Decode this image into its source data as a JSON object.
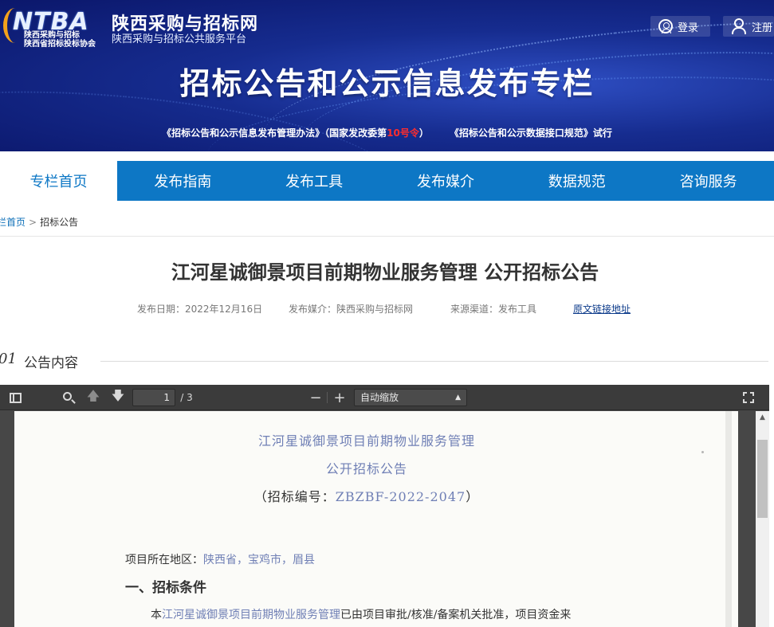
{
  "banner": {
    "logo_text": "NTBA",
    "logo_sub1": "陕西采购与招标",
    "logo_sub2": "陕西省招标投标协会",
    "site_name": "陕西采购与招标网",
    "site_sub": "陕西采购与招标公共服务平台",
    "login_label": "登录",
    "register_label": "注册",
    "title": "招标公告和公示信息发布专栏",
    "notice_part1": "《招标公告和公示信息发布管理办法》（国家发改委第",
    "notice_highlight": "10号令",
    "notice_part2": "）",
    "notice_part3": "《招标公告和公示数据接口规范》试行",
    "accent_color": "#ff2d2d"
  },
  "nav": {
    "items": [
      {
        "label": "专栏首页",
        "active": true
      },
      {
        "label": "发布指南"
      },
      {
        "label": "发布工具"
      },
      {
        "label": "发布媒介"
      },
      {
        "label": "数据规范"
      },
      {
        "label": "咨询服务"
      }
    ],
    "color": "#0d77c5"
  },
  "breadcrumb": {
    "home": "专栏首页",
    "separator": ">",
    "current": "招标公告"
  },
  "article": {
    "title": "江河星诚御景项目前期物业服务管理 公开招标公告",
    "date": "发布日期：2022年12月16日",
    "media": "发布媒介：陕西采购与招标网",
    "source": "来源渠道：发布工具",
    "original_link": "原文链接地址"
  },
  "section": {
    "number": "01",
    "title": "公告内容"
  },
  "pdf_viewer": {
    "current_page": "1",
    "page_count": "/ 3",
    "zoom_out": "−",
    "zoom_in": "+",
    "zoom_value": "自动缩放",
    "document": {
      "line1": "江河星诚御景项目前期物业服务管理",
      "line2": "公开招标公告",
      "code_prefix": "（招标编号：",
      "code_value": "ZBZBF-2022-2047",
      "code_suffix": "）",
      "region_label": "项目所在地区：",
      "region_value": "陕西省，宝鸡市，眉县",
      "heading": "一、招标条件",
      "body_prefix": "本",
      "body_project": "江河星诚御景项目前期物业服务管理",
      "body_suffix": "已由项目审批/核准/备案机关批准，项目资金来"
    }
  }
}
